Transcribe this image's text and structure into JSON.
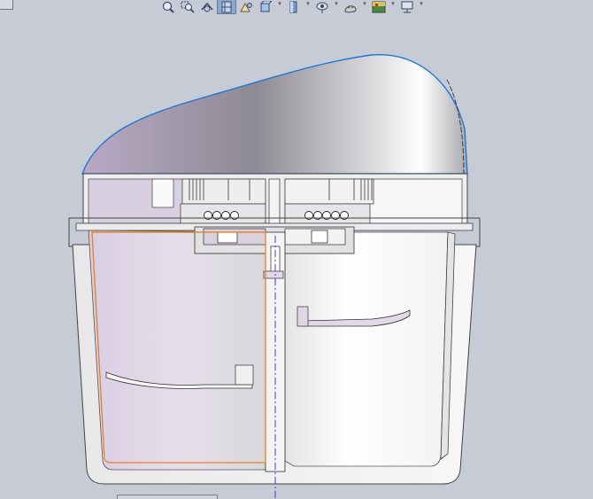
{
  "window": {
    "background": "#c6cbd6"
  },
  "toolbar": {
    "buttons": [
      {
        "name": "zoom-to-fit-icon",
        "active": false,
        "dropdown": false
      },
      {
        "name": "zoom-to-area-icon",
        "active": false,
        "dropdown": false
      },
      {
        "name": "previous-view-icon",
        "active": false,
        "dropdown": false
      },
      {
        "name": "section-view-icon",
        "active": true,
        "dropdown": false
      },
      {
        "name": "dynamic-annotation-icon",
        "active": false,
        "dropdown": false
      },
      {
        "name": "view-orientation-icon",
        "active": false,
        "dropdown": true
      },
      {
        "name": "display-style-icon",
        "active": false,
        "dropdown": true
      },
      {
        "name": "hide-show-items-icon",
        "active": false,
        "dropdown": true
      },
      {
        "name": "edit-appearance-icon",
        "active": false,
        "dropdown": true
      },
      {
        "name": "apply-scene-icon",
        "active": false,
        "dropdown": true
      },
      {
        "name": "view-settings-icon",
        "active": false,
        "dropdown": true
      }
    ]
  },
  "model": {
    "edge_color": "#4a4a4a",
    "highlight_color": "#e8821e",
    "centerline_color": "#3a3adf",
    "selection_edge_color": "#1f78d1",
    "cap_gradient_start": "#b7a8c4",
    "section_face_color": "#eef0f2"
  }
}
